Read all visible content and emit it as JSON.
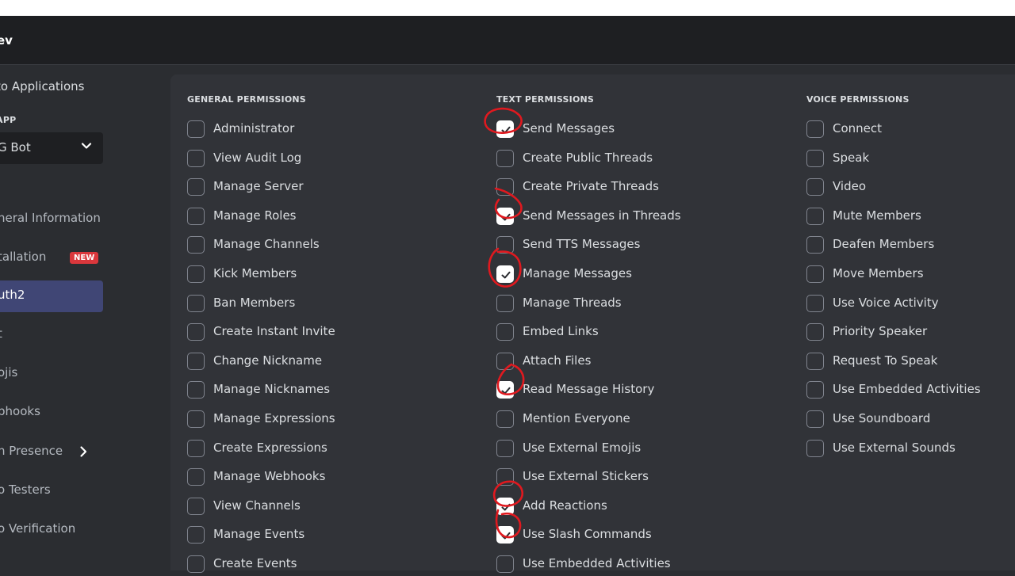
{
  "header": {
    "brand": "ev"
  },
  "sidebar": {
    "back_link": "to Applications",
    "select_label": "APP",
    "selected_app": "G Bot",
    "items": [
      {
        "label": "neral Information"
      },
      {
        "label": "tallation",
        "badge": "NEW"
      },
      {
        "label": "uth2"
      },
      {
        "label": "t"
      },
      {
        "label": "ojis"
      },
      {
        "label": "bhooks"
      },
      {
        "label": "h Presence"
      },
      {
        "label": "o Testers"
      },
      {
        "label": "o Verification"
      }
    ]
  },
  "permissions": {
    "general": {
      "title": "GENERAL PERMISSIONS",
      "items": [
        {
          "label": "Administrator",
          "checked": false
        },
        {
          "label": "View Audit Log",
          "checked": false
        },
        {
          "label": "Manage Server",
          "checked": false
        },
        {
          "label": "Manage Roles",
          "checked": false
        },
        {
          "label": "Manage Channels",
          "checked": false
        },
        {
          "label": "Kick Members",
          "checked": false
        },
        {
          "label": "Ban Members",
          "checked": false
        },
        {
          "label": "Create Instant Invite",
          "checked": false
        },
        {
          "label": "Change Nickname",
          "checked": false
        },
        {
          "label": "Manage Nicknames",
          "checked": false
        },
        {
          "label": "Manage Expressions",
          "checked": false
        },
        {
          "label": "Create Expressions",
          "checked": false
        },
        {
          "label": "Manage Webhooks",
          "checked": false
        },
        {
          "label": "View Channels",
          "checked": false
        },
        {
          "label": "Manage Events",
          "checked": false
        },
        {
          "label": "Create Events",
          "checked": false
        }
      ]
    },
    "text": {
      "title": "TEXT PERMISSIONS",
      "items": [
        {
          "label": "Send Messages",
          "checked": true
        },
        {
          "label": "Create Public Threads",
          "checked": false
        },
        {
          "label": "Create Private Threads",
          "checked": false
        },
        {
          "label": "Send Messages in Threads",
          "checked": true
        },
        {
          "label": "Send TTS Messages",
          "checked": false
        },
        {
          "label": "Manage Messages",
          "checked": true
        },
        {
          "label": "Manage Threads",
          "checked": false
        },
        {
          "label": "Embed Links",
          "checked": false
        },
        {
          "label": "Attach Files",
          "checked": false
        },
        {
          "label": "Read Message History",
          "checked": true
        },
        {
          "label": "Mention Everyone",
          "checked": false
        },
        {
          "label": "Use External Emojis",
          "checked": false
        },
        {
          "label": "Use External Stickers",
          "checked": false
        },
        {
          "label": "Add Reactions",
          "checked": true
        },
        {
          "label": "Use Slash Commands",
          "checked": true
        },
        {
          "label": "Use Embedded Activities",
          "checked": false
        }
      ]
    },
    "voice": {
      "title": "VOICE PERMISSIONS",
      "items": [
        {
          "label": "Connect",
          "checked": false
        },
        {
          "label": "Speak",
          "checked": false
        },
        {
          "label": "Video",
          "checked": false
        },
        {
          "label": "Mute Members",
          "checked": false
        },
        {
          "label": "Deafen Members",
          "checked": false
        },
        {
          "label": "Move Members",
          "checked": false
        },
        {
          "label": "Use Voice Activity",
          "checked": false
        },
        {
          "label": "Priority Speaker",
          "checked": false
        },
        {
          "label": "Request To Speak",
          "checked": false
        },
        {
          "label": "Use Embedded Activities",
          "checked": false
        },
        {
          "label": "Use Soundboard",
          "checked": false
        },
        {
          "label": "Use External Sounds",
          "checked": false
        }
      ]
    }
  },
  "colors": {
    "background": "#2b2d31",
    "header": "#1e1f22",
    "panel": "#313338",
    "active_nav": "#404675",
    "badge": "#da373c",
    "annotation": "#e0191f"
  }
}
